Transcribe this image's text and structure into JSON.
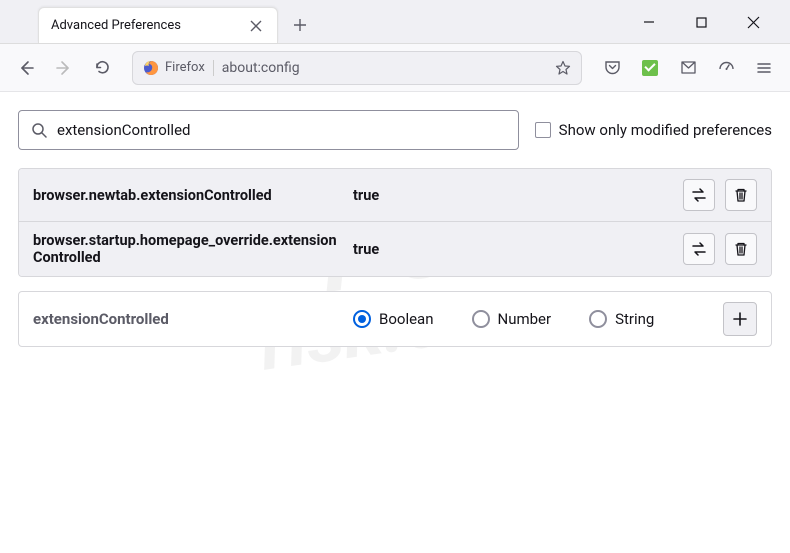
{
  "tab": {
    "title": "Advanced Preferences"
  },
  "urlbar": {
    "identity": "Firefox",
    "url": "about:config"
  },
  "search": {
    "value": "extensionControlled"
  },
  "filter": {
    "label": "Show only modified preferences"
  },
  "prefs": [
    {
      "name": "browser.newtab.extensionControlled",
      "value": "true"
    },
    {
      "name": "browser.startup.homepage_override.extensionControlled",
      "value": "true"
    }
  ],
  "newpref": {
    "name": "extensionControlled",
    "types": {
      "boolean": "Boolean",
      "number": "Number",
      "string": "String"
    }
  }
}
